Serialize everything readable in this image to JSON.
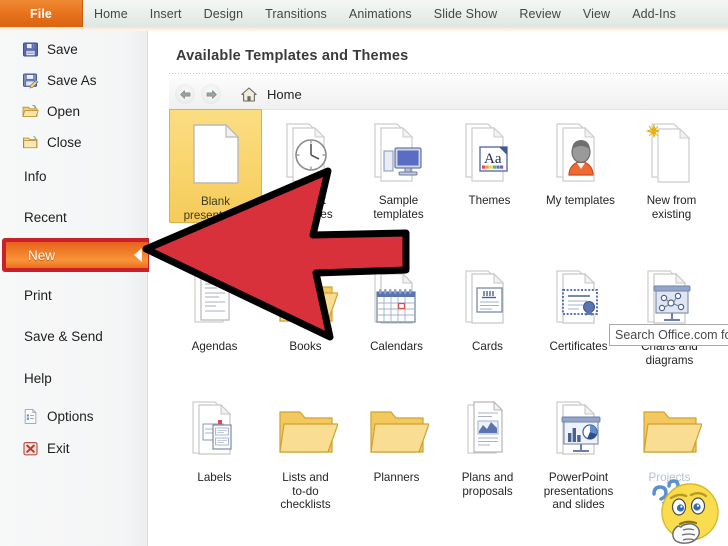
{
  "ribbon": {
    "file_tab": "File",
    "tabs": [
      "Home",
      "Insert",
      "Design",
      "Transitions",
      "Animations",
      "Slide Show",
      "Review",
      "View",
      "Add-Ins"
    ]
  },
  "sidebar": {
    "items": [
      {
        "label": "Save",
        "icon": "floppy-disk-icon",
        "selected": false,
        "has_icon": true
      },
      {
        "label": "Save As",
        "icon": "floppy-pencil-icon",
        "selected": false,
        "has_icon": true
      },
      {
        "label": "Open",
        "icon": "open-folder-icon",
        "selected": false,
        "has_icon": true
      },
      {
        "label": "Close",
        "icon": "close-folder-icon",
        "selected": false,
        "has_icon": true
      },
      {
        "label": "Info",
        "icon": "",
        "selected": false,
        "has_icon": false
      },
      {
        "label": "Recent",
        "icon": "",
        "selected": false,
        "has_icon": false
      },
      {
        "label": "New",
        "icon": "",
        "selected": true,
        "has_icon": false
      },
      {
        "label": "Print",
        "icon": "",
        "selected": false,
        "has_icon": false
      },
      {
        "label": "Save & Send",
        "icon": "",
        "selected": false,
        "has_icon": false
      },
      {
        "label": "Help",
        "icon": "",
        "selected": false,
        "has_icon": false
      },
      {
        "label": "Options",
        "icon": "options-icon",
        "selected": false,
        "has_icon": true
      },
      {
        "label": "Exit",
        "icon": "exit-icon",
        "selected": false,
        "has_icon": true
      }
    ]
  },
  "main": {
    "title": "Available Templates and Themes",
    "nav": {
      "back_icon": "arrow-left-icon",
      "forward_icon": "arrow-right-icon",
      "home_icon": "house-icon",
      "home_label": "Home"
    },
    "search": {
      "placeholder": "Search Office.com for templates",
      "visible_text": "Search Office.com for t"
    },
    "rows": [
      [
        {
          "label": "Blank\npresentation",
          "icon": "blank-page-icon",
          "selected": true
        },
        {
          "label": "Recent\ntemplates",
          "icon": "recent-clock-icon",
          "selected": false
        },
        {
          "label": "Sample\ntemplates",
          "icon": "monitor-icon",
          "selected": false
        },
        {
          "label": "Themes",
          "icon": "themes-aa-icon",
          "selected": false
        },
        {
          "label": "My templates",
          "icon": "person-icon",
          "selected": false
        },
        {
          "label": "New from\nexisting",
          "icon": "new-star-icon",
          "selected": false
        }
      ],
      [
        {
          "label": "Agendas",
          "icon": "agenda-doc-icon",
          "selected": false
        },
        {
          "label": "Books",
          "icon": "folder-icon",
          "selected": false
        },
        {
          "label": "Calendars",
          "icon": "calendar-icon",
          "selected": false
        },
        {
          "label": "Cards",
          "icon": "card-icon",
          "selected": false
        },
        {
          "label": "Certificates",
          "icon": "certificate-icon",
          "selected": false
        },
        {
          "label": "Charts and\ndiagrams",
          "icon": "chart-board-icon",
          "selected": false
        }
      ],
      [
        {
          "label": "Labels",
          "icon": "label-icon",
          "selected": false
        },
        {
          "label": "Lists and\nto-do\nchecklists",
          "icon": "folder-icon",
          "selected": false
        },
        {
          "label": "Planners",
          "icon": "folder-icon",
          "selected": false
        },
        {
          "label": "Plans and\nproposals",
          "icon": "plan-doc-icon",
          "selected": false
        },
        {
          "label": "PowerPoint\npresentations\nand slides",
          "icon": "ppt-board-icon",
          "selected": false
        },
        {
          "label": "Projects",
          "icon": "folder-icon",
          "selected": false
        }
      ]
    ]
  },
  "annotations": {
    "arrow": {
      "name": "red-left-arrow-callout",
      "points_to": "New",
      "fill": "#d8313c",
      "stroke": "#000000"
    },
    "emoji": {
      "name": "thinking-face-emoji",
      "fill": "#f9dd4e"
    }
  },
  "colors": {
    "file_tab_orange": "#e7721d",
    "selected_item_orange": "#ef7c27",
    "selected_item_border": "#c9202a",
    "selected_tile_yellow": "#f8d36a",
    "ribbon_bg": "#e9efeb"
  }
}
